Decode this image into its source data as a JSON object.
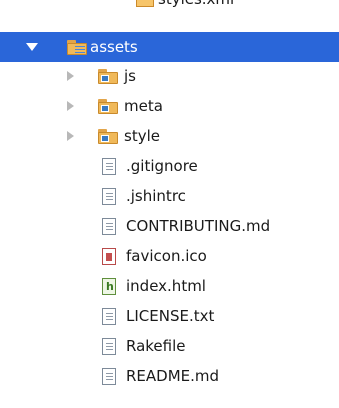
{
  "tree": {
    "top_item": {
      "label": "styles.xml",
      "icon": "xml-file-icon"
    },
    "root": {
      "label": "assets",
      "expanded": true,
      "selected": true,
      "icon": "project-folder-icon",
      "accent": "#2a66d9"
    },
    "folders": [
      {
        "label": "js",
        "icon": "folder-icon"
      },
      {
        "label": "meta",
        "icon": "folder-icon"
      },
      {
        "label": "style",
        "icon": "folder-icon"
      }
    ],
    "files": [
      {
        "label": ".gitignore",
        "icon": "text-file-icon"
      },
      {
        "label": ".jshintrc",
        "icon": "text-file-icon"
      },
      {
        "label": "CONTRIBUTING.md",
        "icon": "text-file-icon"
      },
      {
        "label": "favicon.ico",
        "icon": "image-file-icon"
      },
      {
        "label": "index.html",
        "icon": "html-file-icon"
      },
      {
        "label": "LICENSE.txt",
        "icon": "text-file-icon"
      },
      {
        "label": "Rakefile",
        "icon": "text-file-icon"
      },
      {
        "label": "README.md",
        "icon": "text-file-icon"
      }
    ]
  }
}
